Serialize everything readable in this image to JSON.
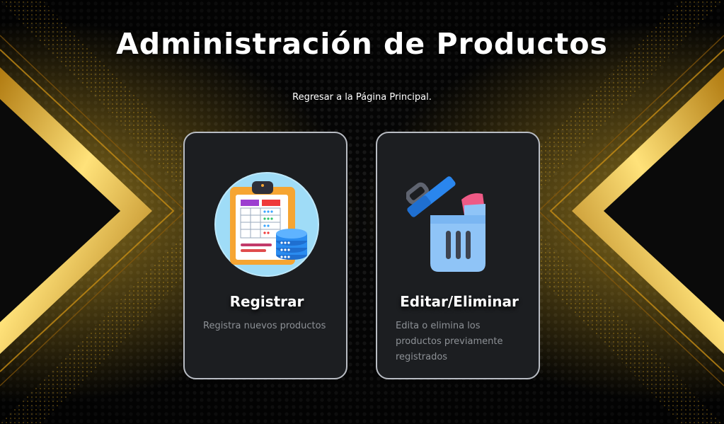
{
  "page": {
    "title": "Administración de Productos",
    "back_link": "Regresar a la Página Principal."
  },
  "cards": [
    {
      "title": "Registrar",
      "description": "Registra nuevos productos",
      "icon": "clipboard-database-icon"
    },
    {
      "title": "Editar/Eliminar",
      "description": "Edita o elimina los productos previamente registrados",
      "icon": "trash-can-icon"
    }
  ],
  "colors": {
    "background": "#050505",
    "gold": "#e8b520",
    "card_bg": "#1c1e21",
    "card_border": "#b9bdc4",
    "desc_text": "#8d9196"
  }
}
